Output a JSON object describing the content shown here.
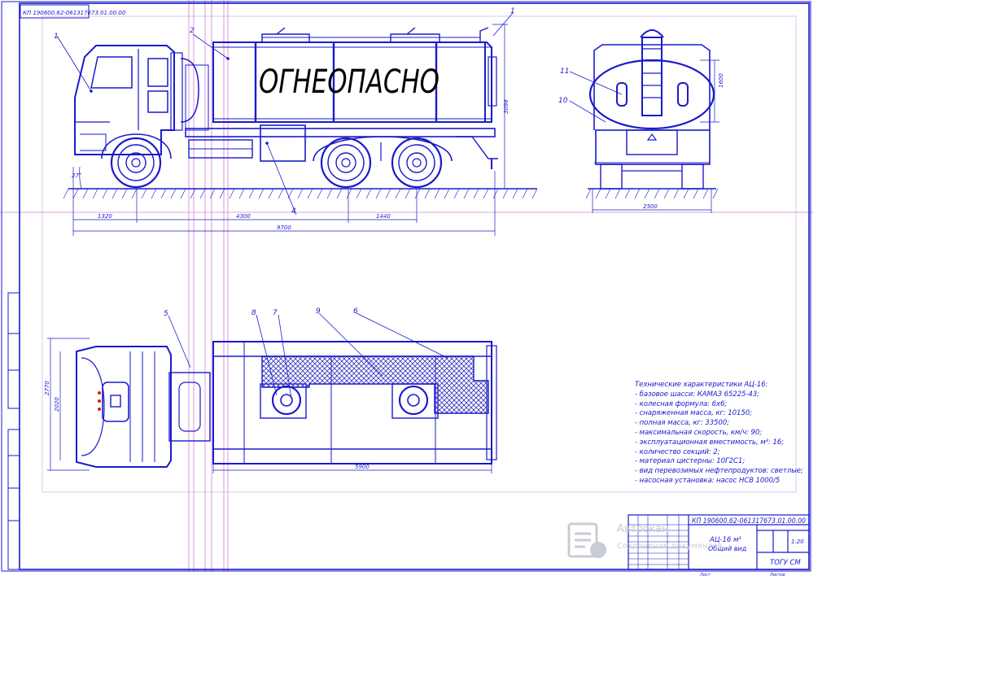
{
  "drawing": {
    "rotated_code": "КП 190600.62-061317673.01.00.00",
    "top_label_1": "1",
    "top_label_2": "2",
    "side_label_1": "1",
    "tank_text": "ОГНЕОПАСНО",
    "callout_11": "11",
    "callout_10": "10",
    "callout_4": "4",
    "callout_5": "5",
    "callout_8": "8",
    "callout_7": "7",
    "callout_9": "9",
    "callout_6": "6",
    "dim_1320": "1320",
    "dim_4300": "4300",
    "dim_1440": "1440",
    "dim_9700": "9700",
    "dim_3098": "3098",
    "dim_1600": "1600",
    "dim_2500": "2500",
    "dim_2770": "2770",
    "dim_2020": "2020",
    "dim_5900": "5900",
    "angle_27": "27°"
  },
  "specs": {
    "title": "Технические характеристики АЦ-16:",
    "lines": [
      "- базовое шасси: КАМАЗ 65225-43;",
      "- колесная формула: 6х6;",
      "- снаряженная масса, кг: 10150;",
      "- полная масса, кг: 33500;",
      "- максимальная скорость, км/ч: 90;",
      "- эксплуатационная вместимость, м³: 16;",
      "- количество секций: 2;",
      "- материал цистерны: 10Г2С1;",
      "- вид перевозимых нефтепродуктов: светлые;",
      "- насосная установка: насос НСВ 1000/5"
    ]
  },
  "title_block": {
    "code": "КП 190600.62-061317673.01.00.00",
    "name_line1": "АЦ-16 м³",
    "name_line2": "Общий вид",
    "scale": "1:20",
    "org": "ТОГУ СМ",
    "sheet_label": "Лист",
    "sheets_label": "Листов"
  },
  "watermark": {
    "name": "Автоскан",
    "sub": "Сохранение документов"
  },
  "colors": {
    "line": "#1a1acc",
    "frame": "#1a1acc",
    "guide_pink": "#d080d0",
    "hatch": "#3a3ac0",
    "watermark": "#c9ccd6"
  }
}
